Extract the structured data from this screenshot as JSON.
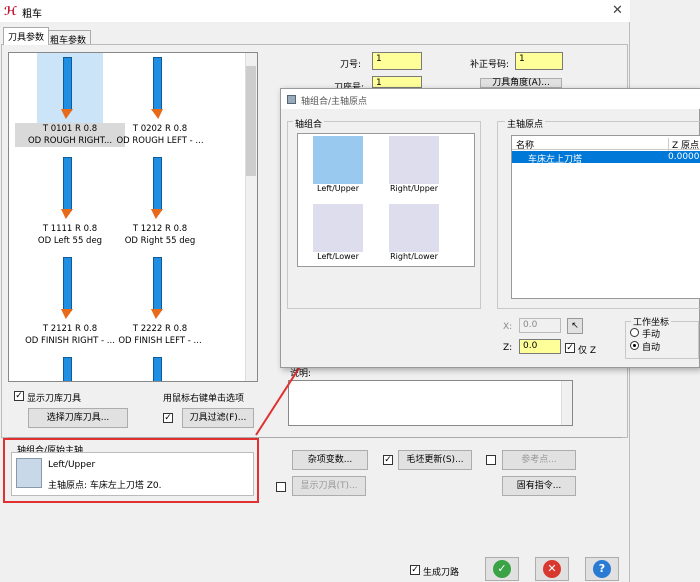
{
  "window": {
    "title": "粗车",
    "close": "✕"
  },
  "tabs": [
    {
      "label": "刀具参数"
    },
    {
      "label": "粗车参数"
    }
  ],
  "tools": [
    {
      "line1": "T 0101 R 0.8",
      "line2": "OD ROUGH RIGHT..."
    },
    {
      "line1": "T 0202 R 0.8",
      "line2": "OD ROUGH LEFT - ..."
    },
    {
      "line1": "T 1111 R 0.8",
      "line2": "OD Left 55 deg"
    },
    {
      "line1": "T 1212 R 0.8",
      "line2": "OD Right 55 deg"
    },
    {
      "line1": "T 2121 R 0.8",
      "line2": "OD FINISH RIGHT - ..."
    },
    {
      "line1": "T 2222 R 0.8",
      "line2": "OD FINISH LEFT - ..."
    }
  ],
  "fields": {
    "tool_no_label": "刀号:",
    "tool_no": "1",
    "comp_no_label": "补正号码:",
    "comp_no": "1",
    "seat_label": "刀座号:",
    "seat_no": "1",
    "tool_angle_btn": "刀具角度(A)...",
    "comment_label": "说明:"
  },
  "left_controls": {
    "show_library": "显示刀库刀具",
    "select_library_btn": "选择刀库刀具...",
    "right_click_hint": "用鼠标右键单击选项",
    "filter_btn": "刀具过滤(F)..."
  },
  "axis_group": {
    "legend": "轴组合/原始主轴",
    "name": "Left/Upper",
    "origin": "主轴原点: 车床左上刀塔   Z0."
  },
  "buttons": {
    "misc": "杂项变数...",
    "stock_update": "毛坯更新(S)...",
    "ref_point": "参考点...",
    "show_tool": "显示刀具(T)...",
    "canned": "固有指令...",
    "gen_toolpath": "生成刀路"
  },
  "overlay": {
    "title": "轴组合/主轴原点",
    "axis_combo_label": "轴组合",
    "spindle_origin_label": "主轴原点",
    "axis_items": [
      "Left/Upper",
      "Right/Upper",
      "Left/Lower",
      "Right/Lower"
    ],
    "table_headers": [
      "名称",
      "Z 原点"
    ],
    "table_row": {
      "name": "车床左上刀塔",
      "z": "0.000000"
    },
    "x_label": "X:",
    "x_value": "0.0",
    "z_label": "Z:",
    "z_value": "0.0",
    "only_z": "仅 Z",
    "work_coord": "工作坐标",
    "manual": "手动",
    "auto": "自动"
  },
  "colors": {
    "highlight": "#0078d7",
    "accent_red": "#e03030",
    "input_yellow": "#ffff99"
  }
}
